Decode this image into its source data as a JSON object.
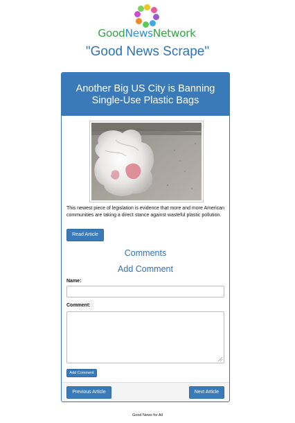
{
  "logo": {
    "word_good": "Good",
    "word_news": "News",
    "word_network": "Network",
    "dot_colors": [
      "#f3c623",
      "#e85a9b",
      "#9b59d0",
      "#3fa9e0",
      "#5cc95a",
      "#f08a2c",
      "#c64fd0",
      "#7ad35a"
    ]
  },
  "site_title": "\"Good News Scrape\"",
  "article": {
    "headline": "Another Big US City is Banning Single-Use Plastic Bags",
    "image_alt": "plastic bags on sidewalk",
    "description": "This newest piece of legislation is evidence that more and more American communities are taking a direct stance against wasteful plastic pollution.",
    "read_button": "Read Article"
  },
  "comments": {
    "heading": "Comments",
    "add_heading": "Add Comment",
    "name_label": "Name:",
    "name_value": "",
    "comment_label": "Comment:",
    "comment_value": "",
    "submit_button": "Add Comment"
  },
  "navigation": {
    "previous_button": "Previous Article",
    "next_button": "Next Article"
  },
  "footer": {
    "text": "Good News for All"
  },
  "colors": {
    "primary": "#3a7ab9",
    "title_blue": "#2f72b7",
    "logo_green": "#35a344",
    "logo_blue": "#2e8fcf"
  }
}
